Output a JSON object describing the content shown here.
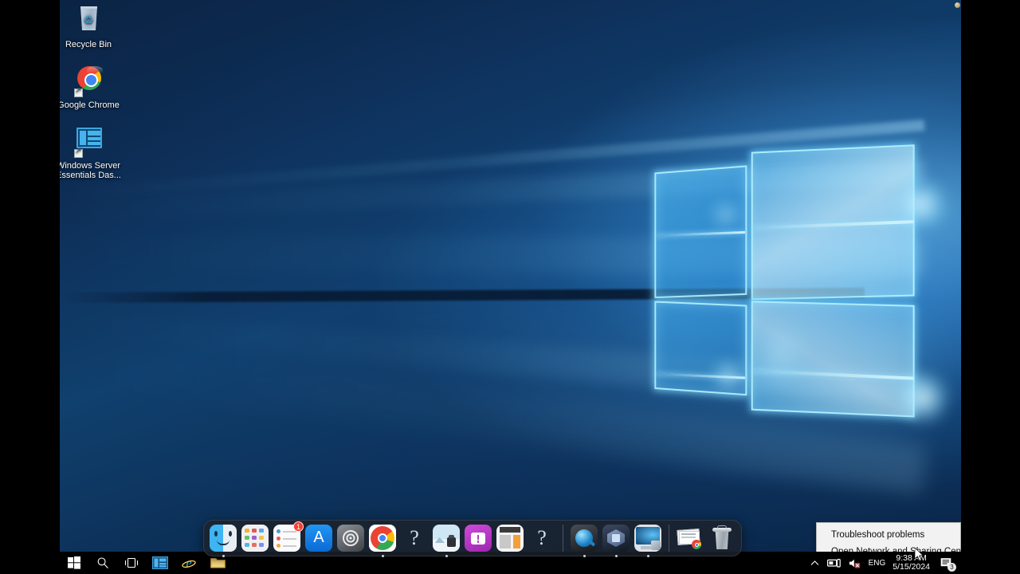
{
  "desktop": {
    "icons": [
      {
        "name": "recycle-bin",
        "label": "Recycle Bin"
      },
      {
        "name": "google-chrome",
        "label": "Google Chrome"
      },
      {
        "name": "windows-server-essentials-dashboard",
        "label": "Windows Server Essentials Das..."
      }
    ]
  },
  "taskbar": {
    "buttons": [
      {
        "name": "start",
        "label": "Start"
      },
      {
        "name": "search",
        "label": "Type here to search"
      },
      {
        "name": "task-view",
        "label": "Task View"
      },
      {
        "name": "windows-server-essentials-dashboard",
        "label": "Windows Server Essentials Dashboard"
      },
      {
        "name": "internet-explorer",
        "label": "Internet Explorer"
      },
      {
        "name": "file-explorer",
        "label": "File Explorer"
      }
    ],
    "tray": {
      "show_hidden_label": "Show hidden icons",
      "network_label": "Network",
      "volume_label": "Volume muted",
      "language": "ENG",
      "time": "9:38 AM",
      "date": "5/15/2024",
      "action_center_badge": "3"
    }
  },
  "context_menu": {
    "items": [
      {
        "name": "troubleshoot-problems",
        "label": "Troubleshoot problems"
      },
      {
        "name": "open-network-and-sharing-center",
        "label": "Open Network and Sharing Center"
      }
    ]
  },
  "dock": {
    "items": [
      {
        "name": "finder",
        "label": "Finder",
        "running": true
      },
      {
        "name": "launchpad",
        "label": "Launchpad",
        "running": false
      },
      {
        "name": "reminders",
        "label": "Reminders",
        "running": false,
        "badge": "1"
      },
      {
        "name": "app-store",
        "label": "App Store",
        "running": false
      },
      {
        "name": "system-preferences",
        "label": "System Preferences",
        "running": false
      },
      {
        "name": "google-chrome",
        "label": "Google Chrome",
        "running": true
      },
      {
        "name": "unknown-app",
        "label": "?",
        "running": false
      },
      {
        "name": "preview",
        "label": "Preview",
        "running": true
      },
      {
        "name": "messages",
        "label": "Messages",
        "running": false
      },
      {
        "name": "calculator",
        "label": "Calculator",
        "running": false
      },
      {
        "name": "unknown-app-2",
        "label": "?",
        "running": false
      },
      {
        "name": "quicktime-player",
        "label": "QuickTime Player",
        "running": true
      },
      {
        "name": "virtualbox",
        "label": "VirtualBox",
        "running": true
      },
      {
        "name": "parallels-windows-vm",
        "label": "Windows 10",
        "running": true
      },
      {
        "name": "documents-stack",
        "label": "Documents",
        "running": false
      },
      {
        "name": "trash",
        "label": "Trash",
        "running": false
      }
    ]
  },
  "colors": {
    "accent": "#0078d7",
    "taskbar_bg": "#000000",
    "menu_bg": "#f2f2f2",
    "badge_red": "#ff3b30"
  }
}
